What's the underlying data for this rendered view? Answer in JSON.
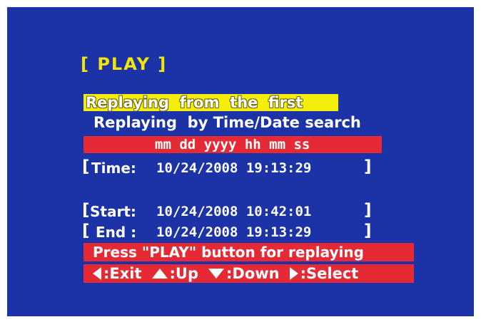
{
  "menu": {
    "title": "[ PLAY ]",
    "options": [
      "Replaying  from  the  first",
      "Replaying  by Time/Date search"
    ],
    "date_format_header": "mm dd yyyy hh mm ss",
    "time": {
      "open": "[",
      "label": "Time:",
      "value": "10/24/2008 19:13:29",
      "close": "]"
    },
    "start": {
      "open": "[",
      "label": "Start:",
      "value": "10/24/2008 10:42:01",
      "close": "]"
    },
    "end": {
      "open": "[",
      "label": "End :",
      "value": "10/24/2008 19:13:29",
      "close": "]"
    },
    "instruction": "Press \"PLAY\" button for replaying",
    "nav": {
      "exit": ":Exit",
      "up": ":Up",
      "down": ":Down",
      "select": ":Select"
    }
  },
  "colors": {
    "background": "#1b33a6",
    "title": "#f2e40a",
    "highlight_yellow": "#f5ee0c",
    "highlight_red": "#e52a35",
    "text": "#ffffff"
  },
  "icons": [
    "arrow-left-icon",
    "arrow-up-icon",
    "arrow-down-icon",
    "arrow-right-icon"
  ]
}
